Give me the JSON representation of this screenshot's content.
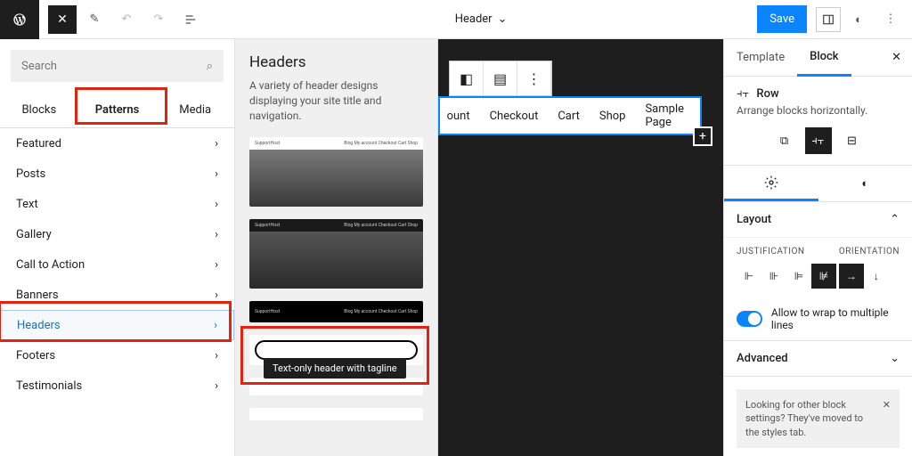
{
  "topbar": {
    "doc_title": "Header",
    "save": "Save"
  },
  "search": {
    "placeholder": "Search"
  },
  "tabs": {
    "blocks": "Blocks",
    "patterns": "Patterns",
    "media": "Media"
  },
  "categories": [
    "Featured",
    "Posts",
    "Text",
    "Gallery",
    "Call to Action",
    "Banners",
    "Headers",
    "Footers",
    "Testimonials"
  ],
  "mid": {
    "title": "Headers",
    "desc": "A variety of header designs displaying your site title and navigation.",
    "tooltip": "Text-only header with tagline"
  },
  "nav_items": [
    "ount",
    "Checkout",
    "Cart",
    "Shop",
    "Sample Page"
  ],
  "rp": {
    "template": "Template",
    "block": "Block",
    "row": "Row",
    "row_desc": "Arrange blocks horizontally.",
    "layout": "Layout",
    "justification": "JUSTIFICATION",
    "orientation": "ORIENTATION",
    "wrap": "Allow to wrap to multiple lines",
    "advanced": "Advanced",
    "notice": "Looking for other block settings? They've moved to the styles tab."
  }
}
